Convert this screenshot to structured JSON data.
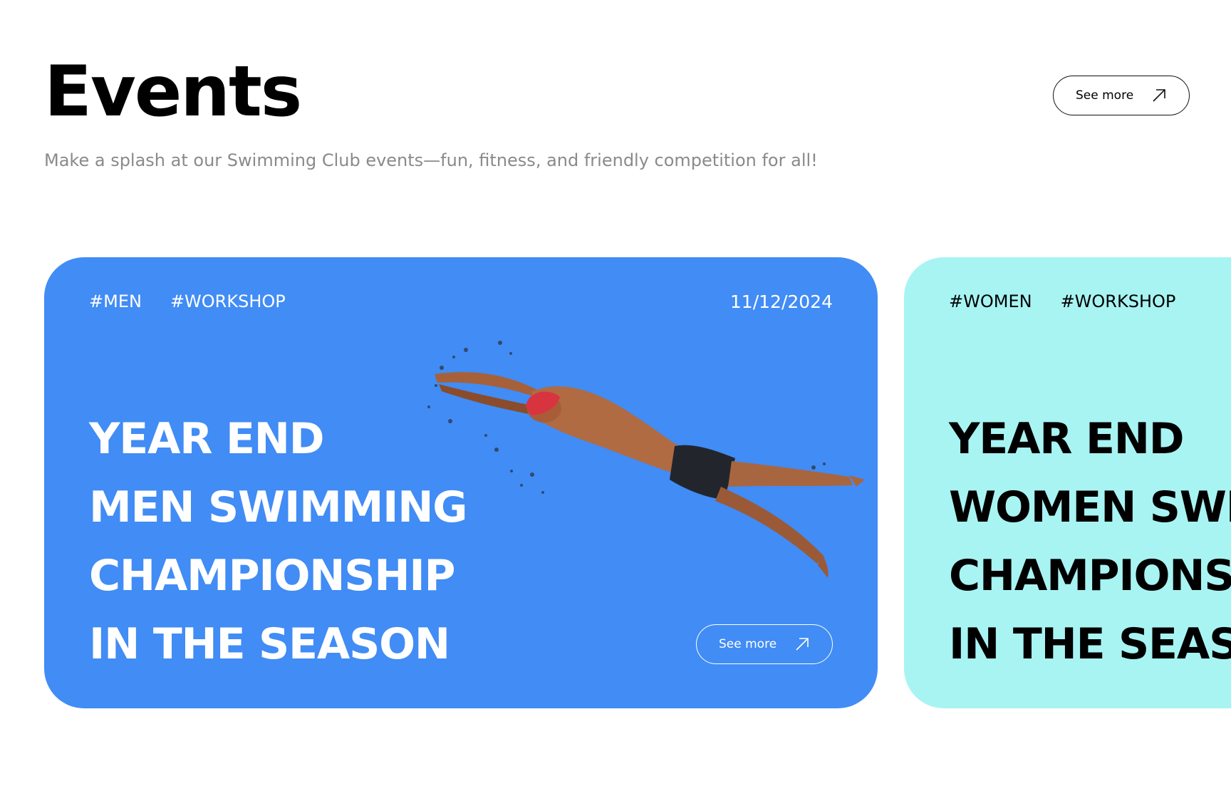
{
  "header": {
    "title": "Events",
    "subtitle": "Make a splash at our Swimming Club events—fun, fitness, and friendly competition for all!",
    "see_more_label": "See more",
    "see_more_icon": "arrow-up-right-icon"
  },
  "events": [
    {
      "tags": [
        "#MEN",
        "#WORKSHOP"
      ],
      "date": "11/12/2024",
      "title_lines": [
        "YEAR END",
        "MEN SWIMMING",
        "CHAMPIONSHIP",
        "IN THE SEASON"
      ],
      "see_more_label": "See more",
      "image": "swimmer-diving-image",
      "background": "#418cf5"
    },
    {
      "tags": [
        "#WOMEN",
        "#WORKSHOP"
      ],
      "title_lines": [
        "YEAR END",
        "WOMEN SWI",
        "CHAMPIONS",
        "IN THE SEASO"
      ],
      "background": "#a7f4f3"
    }
  ],
  "colors": {
    "text": "#000000",
    "muted": "#8a8a8a",
    "card_blue": "#418cf5",
    "card_aqua": "#a7f4f3",
    "swim_cap": "#d8343f"
  }
}
